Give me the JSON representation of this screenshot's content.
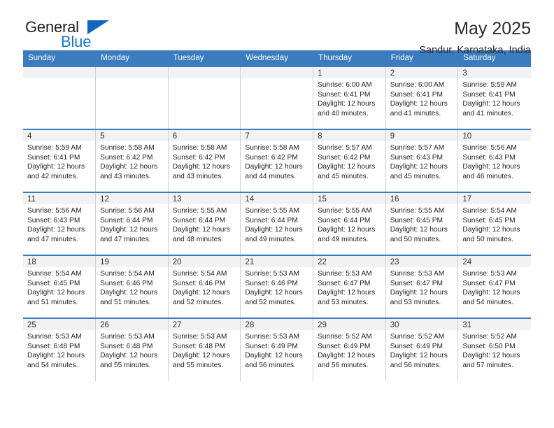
{
  "logo": {
    "word_general": "General",
    "word_blue": "Blue",
    "triangle_color": "#1565c0"
  },
  "header": {
    "title": "May 2025",
    "subtitle": "Sandur, Karnataka, India"
  },
  "theme": {
    "header_blue": "#3a7cbe",
    "day_band_gray": "#f2f2f2",
    "text_dark": "#1f1f1f"
  },
  "weekdays": [
    "Sunday",
    "Monday",
    "Tuesday",
    "Wednesday",
    "Thursday",
    "Friday",
    "Saturday"
  ],
  "weeks": [
    [
      {
        "day": "",
        "sunrise": "",
        "sunset": "",
        "daylight_1": "",
        "daylight_2": ""
      },
      {
        "day": "",
        "sunrise": "",
        "sunset": "",
        "daylight_1": "",
        "daylight_2": ""
      },
      {
        "day": "",
        "sunrise": "",
        "sunset": "",
        "daylight_1": "",
        "daylight_2": ""
      },
      {
        "day": "",
        "sunrise": "",
        "sunset": "",
        "daylight_1": "",
        "daylight_2": ""
      },
      {
        "day": "1",
        "sunrise": "Sunrise: 6:00 AM",
        "sunset": "Sunset: 6:41 PM",
        "daylight_1": "Daylight: 12 hours",
        "daylight_2": "and 40 minutes."
      },
      {
        "day": "2",
        "sunrise": "Sunrise: 6:00 AM",
        "sunset": "Sunset: 6:41 PM",
        "daylight_1": "Daylight: 12 hours",
        "daylight_2": "and 41 minutes."
      },
      {
        "day": "3",
        "sunrise": "Sunrise: 5:59 AM",
        "sunset": "Sunset: 6:41 PM",
        "daylight_1": "Daylight: 12 hours",
        "daylight_2": "and 41 minutes."
      }
    ],
    [
      {
        "day": "4",
        "sunrise": "Sunrise: 5:59 AM",
        "sunset": "Sunset: 6:41 PM",
        "daylight_1": "Daylight: 12 hours",
        "daylight_2": "and 42 minutes."
      },
      {
        "day": "5",
        "sunrise": "Sunrise: 5:58 AM",
        "sunset": "Sunset: 6:42 PM",
        "daylight_1": "Daylight: 12 hours",
        "daylight_2": "and 43 minutes."
      },
      {
        "day": "6",
        "sunrise": "Sunrise: 5:58 AM",
        "sunset": "Sunset: 6:42 PM",
        "daylight_1": "Daylight: 12 hours",
        "daylight_2": "and 43 minutes."
      },
      {
        "day": "7",
        "sunrise": "Sunrise: 5:58 AM",
        "sunset": "Sunset: 6:42 PM",
        "daylight_1": "Daylight: 12 hours",
        "daylight_2": "and 44 minutes."
      },
      {
        "day": "8",
        "sunrise": "Sunrise: 5:57 AM",
        "sunset": "Sunset: 6:42 PM",
        "daylight_1": "Daylight: 12 hours",
        "daylight_2": "and 45 minutes."
      },
      {
        "day": "9",
        "sunrise": "Sunrise: 5:57 AM",
        "sunset": "Sunset: 6:43 PM",
        "daylight_1": "Daylight: 12 hours",
        "daylight_2": "and 45 minutes."
      },
      {
        "day": "10",
        "sunrise": "Sunrise: 5:56 AM",
        "sunset": "Sunset: 6:43 PM",
        "daylight_1": "Daylight: 12 hours",
        "daylight_2": "and 46 minutes."
      }
    ],
    [
      {
        "day": "11",
        "sunrise": "Sunrise: 5:56 AM",
        "sunset": "Sunset: 6:43 PM",
        "daylight_1": "Daylight: 12 hours",
        "daylight_2": "and 47 minutes."
      },
      {
        "day": "12",
        "sunrise": "Sunrise: 5:56 AM",
        "sunset": "Sunset: 6:44 PM",
        "daylight_1": "Daylight: 12 hours",
        "daylight_2": "and 47 minutes."
      },
      {
        "day": "13",
        "sunrise": "Sunrise: 5:55 AM",
        "sunset": "Sunset: 6:44 PM",
        "daylight_1": "Daylight: 12 hours",
        "daylight_2": "and 48 minutes."
      },
      {
        "day": "14",
        "sunrise": "Sunrise: 5:55 AM",
        "sunset": "Sunset: 6:44 PM",
        "daylight_1": "Daylight: 12 hours",
        "daylight_2": "and 49 minutes."
      },
      {
        "day": "15",
        "sunrise": "Sunrise: 5:55 AM",
        "sunset": "Sunset: 6:44 PM",
        "daylight_1": "Daylight: 12 hours",
        "daylight_2": "and 49 minutes."
      },
      {
        "day": "16",
        "sunrise": "Sunrise: 5:55 AM",
        "sunset": "Sunset: 6:45 PM",
        "daylight_1": "Daylight: 12 hours",
        "daylight_2": "and 50 minutes."
      },
      {
        "day": "17",
        "sunrise": "Sunrise: 5:54 AM",
        "sunset": "Sunset: 6:45 PM",
        "daylight_1": "Daylight: 12 hours",
        "daylight_2": "and 50 minutes."
      }
    ],
    [
      {
        "day": "18",
        "sunrise": "Sunrise: 5:54 AM",
        "sunset": "Sunset: 6:45 PM",
        "daylight_1": "Daylight: 12 hours",
        "daylight_2": "and 51 minutes."
      },
      {
        "day": "19",
        "sunrise": "Sunrise: 5:54 AM",
        "sunset": "Sunset: 6:46 PM",
        "daylight_1": "Daylight: 12 hours",
        "daylight_2": "and 51 minutes."
      },
      {
        "day": "20",
        "sunrise": "Sunrise: 5:54 AM",
        "sunset": "Sunset: 6:46 PM",
        "daylight_1": "Daylight: 12 hours",
        "daylight_2": "and 52 minutes."
      },
      {
        "day": "21",
        "sunrise": "Sunrise: 5:53 AM",
        "sunset": "Sunset: 6:46 PM",
        "daylight_1": "Daylight: 12 hours",
        "daylight_2": "and 52 minutes."
      },
      {
        "day": "22",
        "sunrise": "Sunrise: 5:53 AM",
        "sunset": "Sunset: 6:47 PM",
        "daylight_1": "Daylight: 12 hours",
        "daylight_2": "and 53 minutes."
      },
      {
        "day": "23",
        "sunrise": "Sunrise: 5:53 AM",
        "sunset": "Sunset: 6:47 PM",
        "daylight_1": "Daylight: 12 hours",
        "daylight_2": "and 53 minutes."
      },
      {
        "day": "24",
        "sunrise": "Sunrise: 5:53 AM",
        "sunset": "Sunset: 6:47 PM",
        "daylight_1": "Daylight: 12 hours",
        "daylight_2": "and 54 minutes."
      }
    ],
    [
      {
        "day": "25",
        "sunrise": "Sunrise: 5:53 AM",
        "sunset": "Sunset: 6:48 PM",
        "daylight_1": "Daylight: 12 hours",
        "daylight_2": "and 54 minutes."
      },
      {
        "day": "26",
        "sunrise": "Sunrise: 5:53 AM",
        "sunset": "Sunset: 6:48 PM",
        "daylight_1": "Daylight: 12 hours",
        "daylight_2": "and 55 minutes."
      },
      {
        "day": "27",
        "sunrise": "Sunrise: 5:53 AM",
        "sunset": "Sunset: 6:48 PM",
        "daylight_1": "Daylight: 12 hours",
        "daylight_2": "and 55 minutes."
      },
      {
        "day": "28",
        "sunrise": "Sunrise: 5:53 AM",
        "sunset": "Sunset: 6:49 PM",
        "daylight_1": "Daylight: 12 hours",
        "daylight_2": "and 56 minutes."
      },
      {
        "day": "29",
        "sunrise": "Sunrise: 5:52 AM",
        "sunset": "Sunset: 6:49 PM",
        "daylight_1": "Daylight: 12 hours",
        "daylight_2": "and 56 minutes."
      },
      {
        "day": "30",
        "sunrise": "Sunrise: 5:52 AM",
        "sunset": "Sunset: 6:49 PM",
        "daylight_1": "Daylight: 12 hours",
        "daylight_2": "and 56 minutes."
      },
      {
        "day": "31",
        "sunrise": "Sunrise: 5:52 AM",
        "sunset": "Sunset: 6:50 PM",
        "daylight_1": "Daylight: 12 hours",
        "daylight_2": "and 57 minutes."
      }
    ]
  ]
}
